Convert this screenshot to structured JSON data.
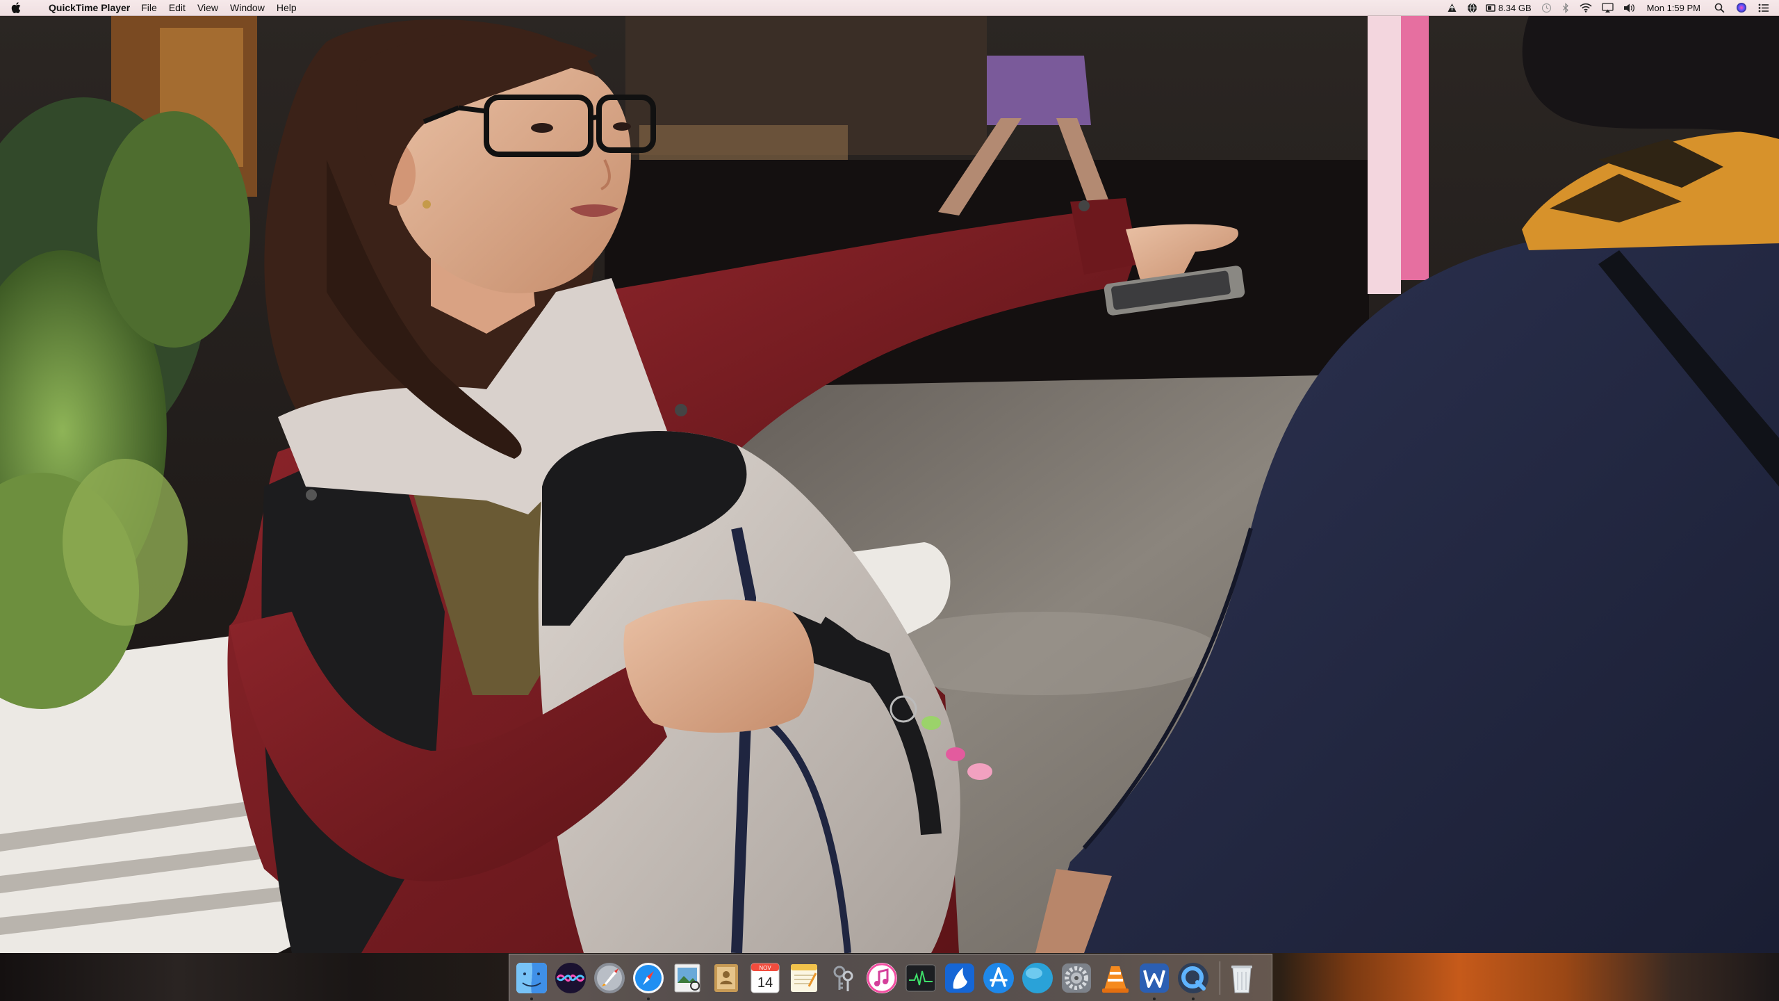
{
  "menubar": {
    "app_name": "QuickTime Player",
    "menus": [
      "File",
      "Edit",
      "View",
      "Window",
      "Help"
    ],
    "status_icons": [
      "upload-icon",
      "globe-icon",
      "memory-icon",
      "clock-icon",
      "bluetooth-icon",
      "wifi-icon",
      "airplay-icon",
      "volume-icon",
      "spotlight-icon",
      "siri-icon",
      "notification-center-icon"
    ],
    "memory_label": "8.34 GB",
    "clock": "Mon 1:59 PM"
  },
  "dock": {
    "apps": [
      {
        "name": "Finder",
        "icon": "finder-icon",
        "running": true
      },
      {
        "name": "Siri",
        "icon": "siri-icon",
        "running": false
      },
      {
        "name": "Launchpad",
        "icon": "launchpad-icon",
        "running": false
      },
      {
        "name": "Safari",
        "icon": "safari-icon",
        "running": true
      },
      {
        "name": "Preview",
        "icon": "preview-icon",
        "running": false
      },
      {
        "name": "Contacts",
        "icon": "contacts-icon",
        "running": false
      },
      {
        "name": "Calendar",
        "icon": "calendar-icon",
        "running": false,
        "month": "NOV",
        "day": "14"
      },
      {
        "name": "Notes",
        "icon": "notes-icon",
        "running": false
      },
      {
        "name": "Keychain Access",
        "icon": "keychain-icon",
        "running": false
      },
      {
        "name": "iTunes",
        "icon": "itunes-icon",
        "running": false
      },
      {
        "name": "Activity Monitor",
        "icon": "activity-monitor-icon",
        "running": false
      },
      {
        "name": "Cleaner",
        "icon": "cleaner-icon",
        "running": false
      },
      {
        "name": "App Store",
        "icon": "app-store-icon",
        "running": false
      },
      {
        "name": "Browser",
        "icon": "blue-sphere-icon",
        "running": false
      },
      {
        "name": "System Preferences",
        "icon": "system-preferences-icon",
        "running": false
      },
      {
        "name": "VLC",
        "icon": "vlc-icon",
        "running": false
      },
      {
        "name": "Word",
        "icon": "word-icon",
        "running": true
      },
      {
        "name": "QuickTime Player",
        "icon": "quicktime-icon",
        "running": true
      }
    ],
    "trash": {
      "name": "Trash",
      "icon": "trash-icon"
    }
  },
  "colors": {
    "menubar_bg": "#f3e4e6",
    "jacket": "#7b1d22",
    "backpack": "#cfc6c1",
    "navy_jacket": "#252b45"
  }
}
